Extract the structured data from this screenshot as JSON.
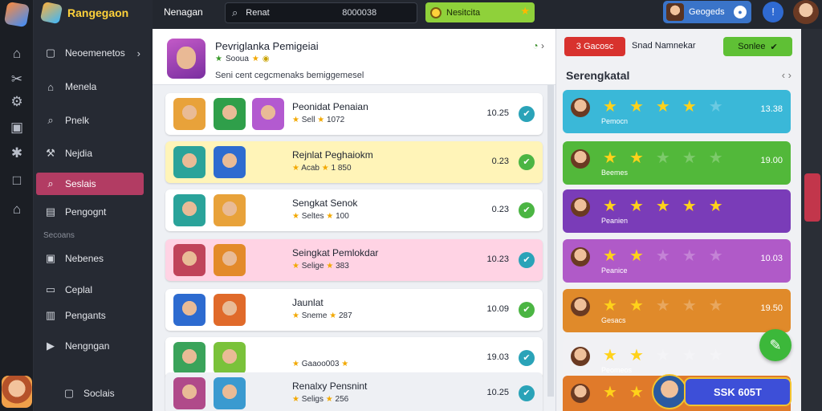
{
  "rail": {
    "icons": [
      "home-icon",
      "tools-icon",
      "gear-icon",
      "shield-icon",
      "bug-icon",
      "square-icon",
      "bank-icon"
    ]
  },
  "sidebar": {
    "brand": "Rangegaon",
    "items": [
      {
        "label": "Neoemenetos",
        "icon": "square-icon",
        "has_chevron": true
      },
      {
        "label": "Menela",
        "icon": "house-icon"
      },
      {
        "label": "Pnelk",
        "icon": "search-icon"
      },
      {
        "label": "Nejdia",
        "icon": "hammer-icon"
      },
      {
        "label": "Seslais",
        "icon": "search-icon",
        "active": true
      },
      {
        "label": "Pengognt",
        "icon": "doc-icon"
      }
    ],
    "section_label": "Secoans",
    "section_items": [
      {
        "label": "Nebenes",
        "icon": "image-icon"
      },
      {
        "label": "Ceplal",
        "icon": "doc-icon"
      },
      {
        "label": "Pengants",
        "icon": "chart-icon"
      },
      {
        "label": "Nengngan",
        "icon": "video-icon"
      },
      {
        "label": "Soclais",
        "icon": "square-icon"
      }
    ]
  },
  "topbar": {
    "title": "Nenagan",
    "search_value": "Renat",
    "search_number": "8000038",
    "chip_label": "Nesitcita",
    "profile_label": "Geogeds"
  },
  "header": {
    "title": "Pevriglanka Pemigeiai",
    "subtitle": "Sooua",
    "description": "Seni cent cegcmenaks bemiggemesel"
  },
  "rows": [
    {
      "name": "Peonidat Penaian",
      "meta": "Sell",
      "meta_value": "1072",
      "value": "10.25",
      "check": "teal",
      "bg": "#ffffff",
      "thumbs": [
        "#e8a23a",
        "#2f9f4a",
        "#b35ad0"
      ]
    },
    {
      "name": "Rejnlat Peghaiokm",
      "meta": "Acab",
      "meta_value": "1 850",
      "value": "0.23",
      "check": "green",
      "bg": "#fff4b8",
      "thumbs": [
        "#2aa39a",
        "#2d6bd0"
      ]
    },
    {
      "name": "Sengkat Senok",
      "meta": "Seltes",
      "meta_value": "100",
      "value": "0.23",
      "check": "green",
      "bg": "#ffffff",
      "thumbs": [
        "#2aa39a",
        "#e8a23a"
      ]
    },
    {
      "name": "Seingkat Pemlokdar",
      "meta": "Selige",
      "meta_value": "383",
      "value": "10.23",
      "check": "teal",
      "bg": "#ffd3e4",
      "thumbs": [
        "#c0435a",
        "#e38a2a"
      ]
    },
    {
      "name": "Jaunlat",
      "meta": "Sneme",
      "meta_value": "287",
      "value": "10.09",
      "check": "green",
      "bg": "#ffffff",
      "thumbs": [
        "#2d6bd0",
        "#e06a2a"
      ]
    },
    {
      "name": "",
      "meta": "Gaaoo003",
      "meta_value": "",
      "value": "19.03",
      "check": "teal",
      "bg": "#ffffff",
      "thumbs": [
        "#3aa35a",
        "#7ac23a"
      ]
    },
    {
      "name": "Renalxy Pensnint",
      "meta": "Seligs",
      "meta_value": "256",
      "value": "10.25",
      "check": "teal",
      "bg": "#eef0f4",
      "thumbs": [
        "#b04a8a",
        "#3a9ad0"
      ]
    }
  ],
  "right": {
    "red_button": "3 Gacosc",
    "label": "Snad Namnekar",
    "green_button": "Sonlee",
    "title": "Serengkatal",
    "ratings": [
      {
        "label": "Pemocn",
        "stars": 4,
        "value": "13.38",
        "color": "#3ab8d8"
      },
      {
        "label": "Beemes",
        "stars": 2,
        "value": "19.00",
        "color": "#52b83a"
      },
      {
        "label": "Peanien",
        "stars": 5,
        "value": "",
        "color": "#7a3cb8"
      },
      {
        "label": "Peanice",
        "stars": 2,
        "value": "10.03",
        "color": "#b05ac8"
      },
      {
        "label": "Gesacs",
        "stars": 2,
        "value": "19.50",
        "color": "#e08a2a"
      },
      {
        "label": "Peomeos",
        "stars": 2,
        "value": "",
        "color": "#f1f1f4"
      },
      {
        "label": "",
        "stars": 2,
        "value": "",
        "color": "#e07a2a"
      }
    ],
    "cta": "SSK 605T"
  }
}
